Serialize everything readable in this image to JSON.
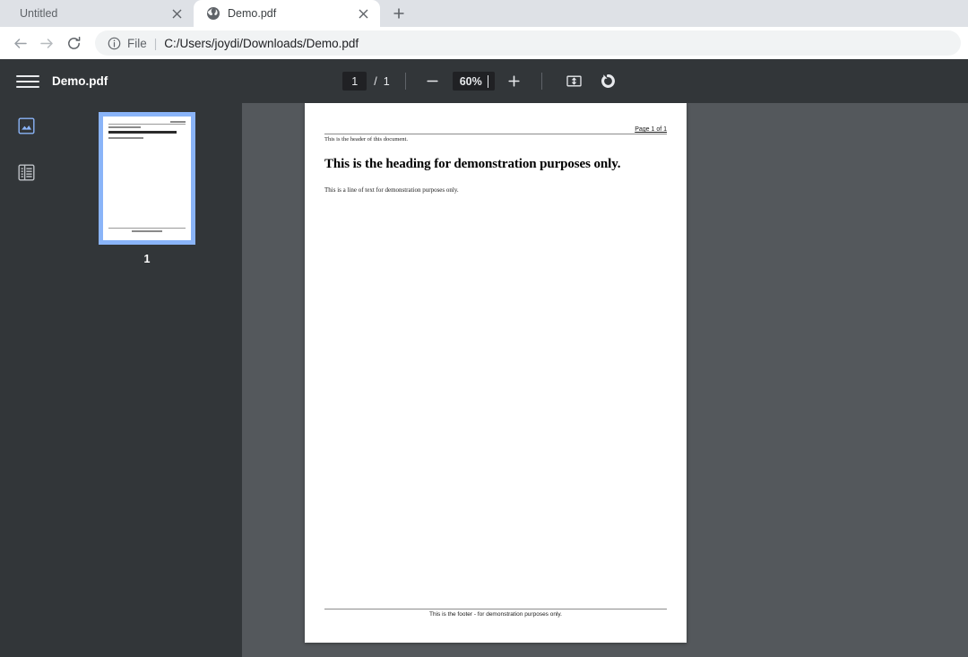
{
  "browser": {
    "tabs": [
      {
        "title": "Untitled",
        "favicon": "none",
        "active": false,
        "close_icon": "close-icon"
      },
      {
        "title": "Demo.pdf",
        "favicon": "globe-icon",
        "active": true,
        "close_icon": "close-icon"
      }
    ],
    "new_tab_icon": "plus-icon",
    "nav": {
      "back_icon": "arrow-left-icon",
      "forward_icon": "arrow-right-icon",
      "reload_icon": "reload-icon"
    },
    "omnibox": {
      "info_icon": "info-circle-icon",
      "scheme_label": "File",
      "separator": "|",
      "url": "C:/Users/joydi/Downloads/Demo.pdf"
    }
  },
  "pdf_viewer": {
    "menu_icon": "hamburger-menu-icon",
    "document_title": "Demo.pdf",
    "page_number": "1",
    "page_separator": "/",
    "page_count": "1",
    "zoom_out_icon": "minus-icon",
    "zoom_level": "60%",
    "zoom_in_icon": "plus-icon",
    "fit_page_icon": "fit-to-page-icon",
    "rotate_icon": "rotate-clockwise-icon",
    "sidebar": {
      "thumbnails_icon": "thumbnail-view-icon",
      "outline_icon": "document-outline-icon",
      "active_panel": "thumbnails",
      "thumbnail_label": "1"
    },
    "page_content": {
      "page_indicator": "Page 1 of 1",
      "header": "This is the header of this document.",
      "heading": "This is the heading for demonstration purposes only.",
      "body": "This is a line of text for demonstration purposes only.",
      "footer": "This is the footer - for demonstration purposes only."
    }
  },
  "colors": {
    "tabstrip_bg": "#dee1e6",
    "toolbar_bg": "#323639",
    "canvas_bg": "#54585c",
    "accent_blue": "#8ab4f8",
    "field_bg": "#202124"
  }
}
